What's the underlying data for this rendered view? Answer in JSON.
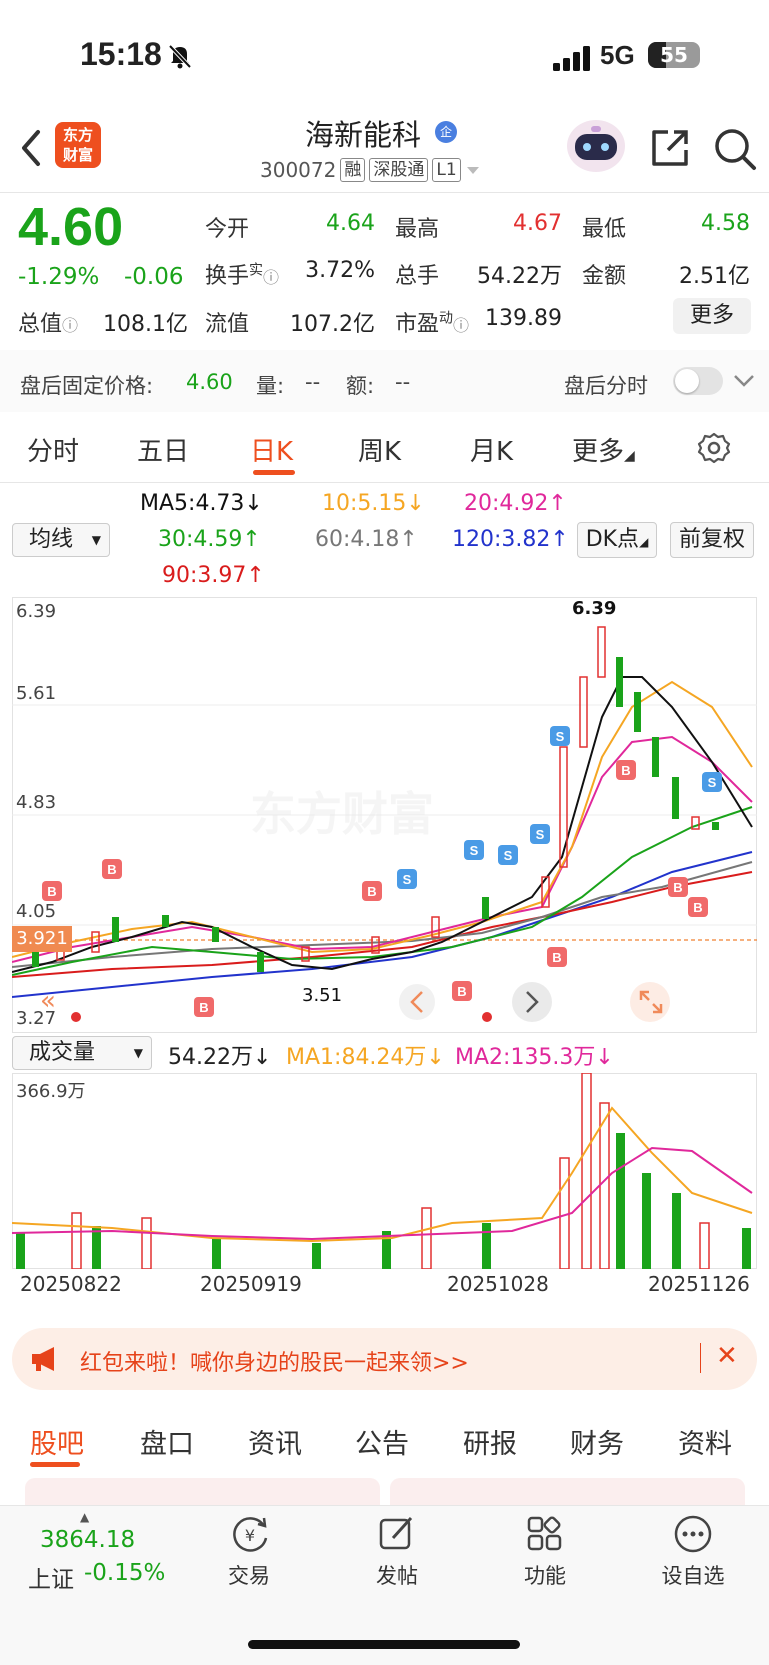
{
  "status": {
    "time": "15:18",
    "network": "5G",
    "battery": "55"
  },
  "header": {
    "logo": "东方财富",
    "stock_name": "海新能科",
    "badge": "企",
    "code": "300072",
    "tags": [
      "融",
      "深股通",
      "L1"
    ]
  },
  "quote": {
    "price": "4.60",
    "change_pct": "-1.29%",
    "change": "-0.06",
    "fields": [
      {
        "label": "今开",
        "value": "4.64",
        "color": "green"
      },
      {
        "label": "最高",
        "value": "4.67",
        "color": "red"
      },
      {
        "label": "最低",
        "value": "4.58",
        "color": "green"
      },
      {
        "label": "换手",
        "sup": "实",
        "value": "3.72%",
        "color": "dark"
      },
      {
        "label": "总手",
        "value": "54.22万",
        "color": "dark"
      },
      {
        "label": "金额",
        "value": "2.51亿",
        "color": "dark"
      },
      {
        "label": "总值",
        "value": "108.1亿",
        "color": "dark"
      },
      {
        "label": "流值",
        "value": "107.2亿",
        "color": "dark"
      },
      {
        "label": "市盈",
        "sup": "动",
        "value": "139.89",
        "color": "dark"
      }
    ],
    "more_label": "更多"
  },
  "after_hours": {
    "label": "盘后固定价格:",
    "price": "4.60",
    "vol_label": "量:",
    "vol": "--",
    "amt_label": "额:",
    "amt": "--",
    "timeshare_label": "盘后分时"
  },
  "tabs": [
    "分时",
    "五日",
    "日K",
    "周K",
    "月K",
    "更多"
  ],
  "active_tab": "日K",
  "ma": {
    "selector": "均线",
    "ma5": "MA5:4.73↓",
    "ma10": "10:5.15↓",
    "ma20": "20:4.92↑",
    "ma30": "30:4.59↑",
    "ma60": "60:4.18↑",
    "ma120": "120:3.82↑",
    "ma90": "90:3.97↑",
    "dk_button": "DK点",
    "fq_button": "前复权",
    "colors": {
      "ma5": "#111111",
      "ma10": "#f5a623",
      "ma20": "#e0289b",
      "ma30": "#1aa31a",
      "ma60": "#777777",
      "ma120": "#2233cc",
      "ma90": "#d91c1c"
    }
  },
  "kline_axis": {
    "y_top": "6.39",
    "y2": "5.61",
    "y3": "4.83",
    "y4": "4.05",
    "y_bottom": "3.27",
    "current": "3.921",
    "high_mark": "6.39",
    "low_mark": "3.51"
  },
  "volume": {
    "selector": "成交量",
    "value": "54.22万↓",
    "ma1": "MA1:84.24万↓",
    "ma2": "MA2:135.3万↓",
    "y_max": "366.9万"
  },
  "dates": [
    "20250822",
    "20250919",
    "20251028",
    "20251126"
  ],
  "banner": {
    "text": "红包来啦！喊你身边的股民一起来领>>"
  },
  "bottom_tabs": [
    "股吧",
    "盘口",
    "资讯",
    "公告",
    "研报",
    "财务",
    "资料"
  ],
  "nav": {
    "index_value": "3864.18",
    "index_name": "上证",
    "index_change": "-0.15%",
    "items": [
      "交易",
      "发帖",
      "功能",
      "设自选"
    ]
  }
}
